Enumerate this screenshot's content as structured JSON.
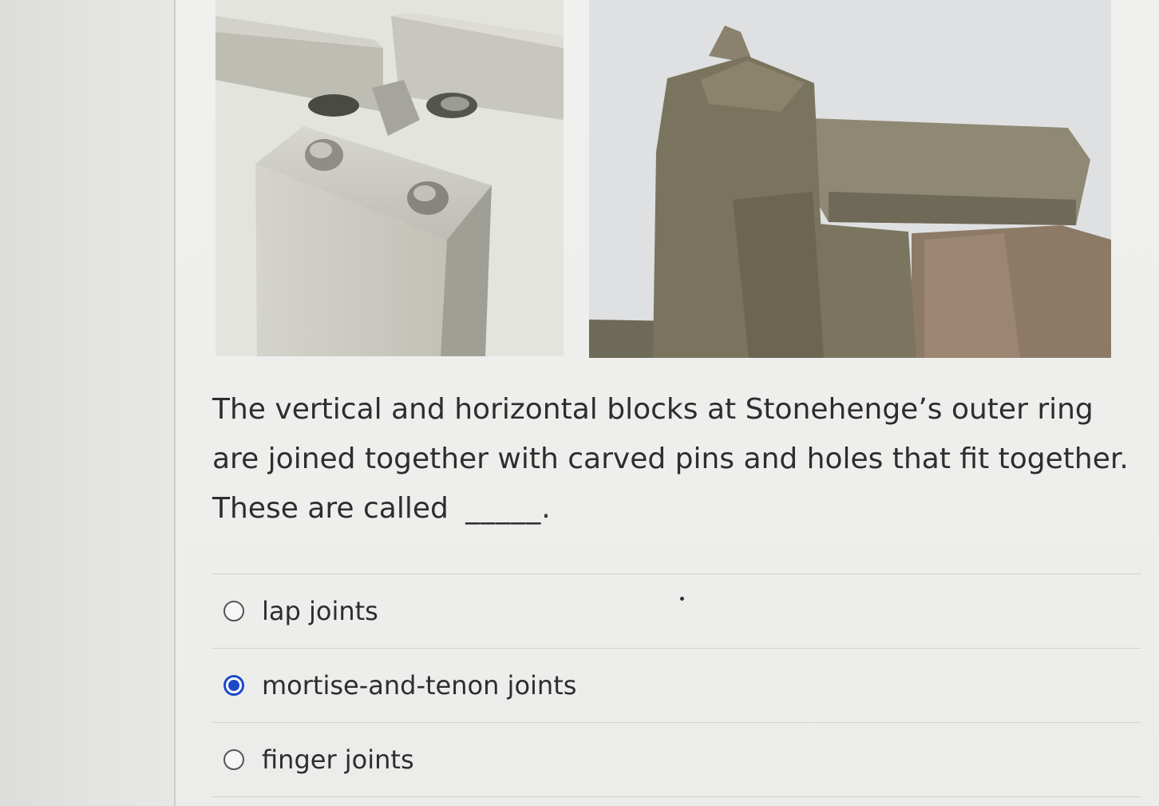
{
  "question": {
    "text": "The vertical and horizontal blocks at Stonehenge’s outer ring are joined together with carved pins and holes that fit together.  These are called",
    "blank": "_____."
  },
  "images": {
    "left_icon": "joint-illustration",
    "right_icon": "stonehenge-photo"
  },
  "options": [
    {
      "label": "lap joints",
      "selected": false
    },
    {
      "label": "mortise-and-tenon joints",
      "selected": true
    },
    {
      "label": "finger joints",
      "selected": false
    }
  ],
  "colors": {
    "accent": "#1c49c9",
    "text": "#2d2d2d",
    "background": "#ecedeb"
  }
}
